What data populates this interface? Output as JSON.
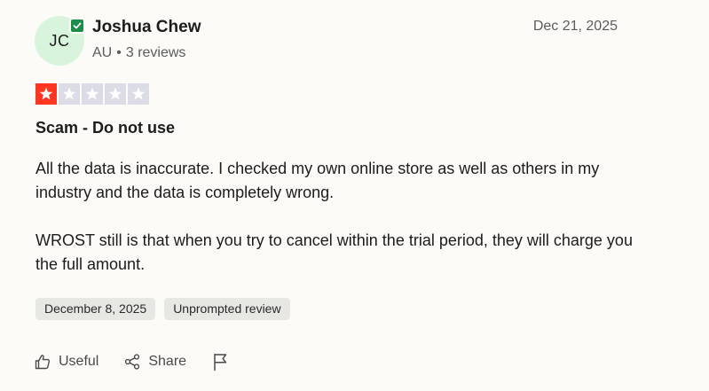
{
  "reviewer": {
    "initials": "JC",
    "name": "Joshua Chew",
    "country": "AU",
    "separator": "•",
    "review_count": "3 reviews"
  },
  "review": {
    "date": "Dec 21, 2025",
    "rating": 1,
    "rating_max": 5,
    "title": "Scam - Do not use",
    "body": [
      "All the data is inaccurate. I checked my own online store as well as others in my industry and the data is completely wrong.",
      "WROST still is that when you try to cancel within the trial period, they will charge you the full amount."
    ],
    "tags": [
      "December 8, 2025",
      "Unprompted review"
    ]
  },
  "actions": {
    "useful_label": "Useful",
    "share_label": "Share"
  },
  "colors": {
    "star_on": "#ff3722",
    "star_off": "#dcdce6",
    "avatar_bg": "#d9f4dd",
    "verified": "#1b8c4a"
  },
  "icons": {
    "verified": "verified-check-icon",
    "star": "star-icon",
    "useful": "thumbs-up-icon",
    "share": "share-icon",
    "report": "flag-icon"
  }
}
